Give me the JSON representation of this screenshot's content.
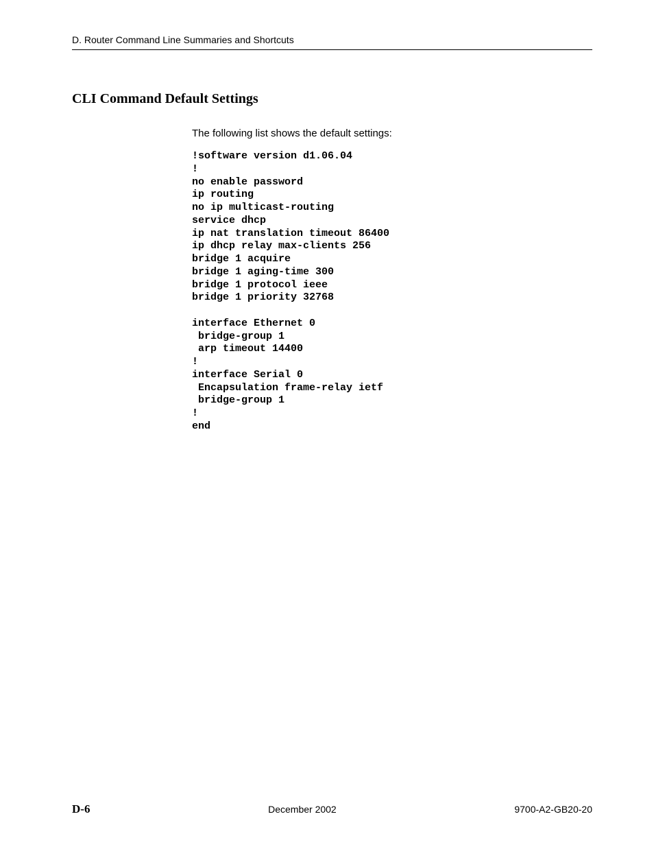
{
  "header": {
    "running_title": "D. Router Command Line Summaries and Shortcuts"
  },
  "section": {
    "title": "CLI Command Default Settings",
    "intro": "The following list shows the default settings:",
    "code": "!software version d1.06.04\n!\nno enable password\nip routing\nno ip multicast-routing\nservice dhcp\nip nat translation timeout 86400\nip dhcp relay max-clients 256\nbridge 1 acquire\nbridge 1 aging-time 300\nbridge 1 protocol ieee\nbridge 1 priority 32768\n\ninterface Ethernet 0\n bridge-group 1\n arp timeout 14400\n!\ninterface Serial 0\n Encapsulation frame-relay ietf\n bridge-group 1\n!\nend"
  },
  "footer": {
    "page_number": "D-6",
    "date": "December 2002",
    "doc_id": "9700-A2-GB20-20"
  }
}
